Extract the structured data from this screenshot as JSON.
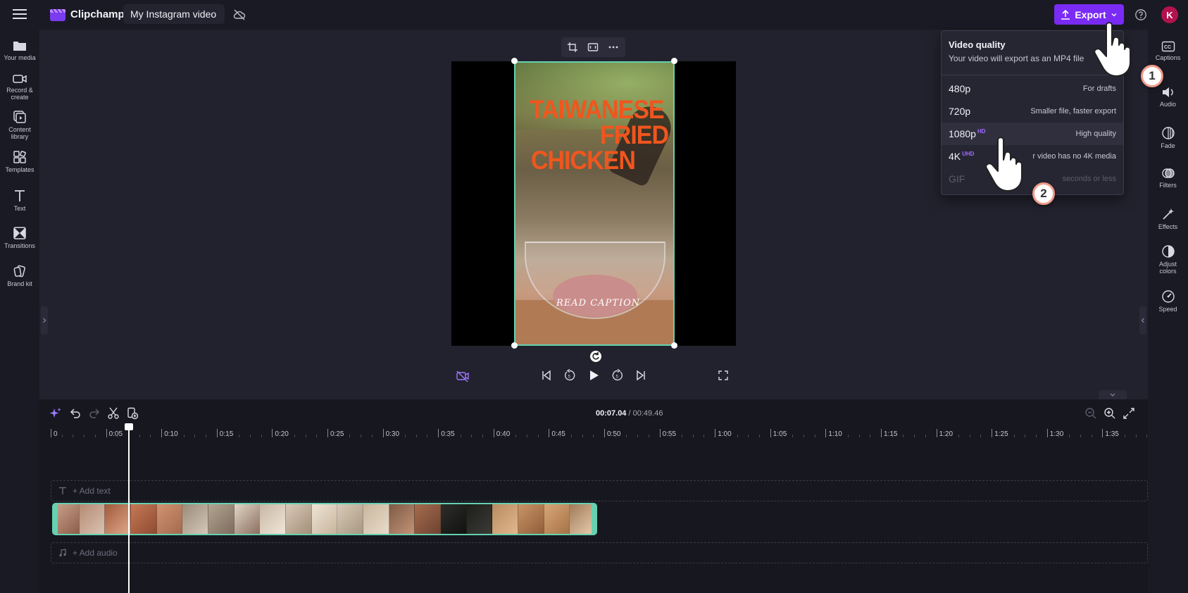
{
  "app": {
    "name": "Clipchamp",
    "project_title": "My Instagram video",
    "avatar_initial": "K",
    "export_label": "Export",
    "accent_color": "#7a2bf5"
  },
  "left_sidebar": {
    "items": [
      {
        "label": "Your media",
        "icon": "folder-icon"
      },
      {
        "label": "Record &",
        "label2": "create",
        "icon": "camera-icon"
      },
      {
        "label": "Content",
        "label2": "library",
        "icon": "library-icon"
      },
      {
        "label": "Templates",
        "icon": "templates-icon"
      },
      {
        "label": "Text",
        "icon": "text-icon"
      },
      {
        "label": "Transitions",
        "icon": "transitions-icon"
      },
      {
        "label": "Brand kit",
        "icon": "brand-kit-icon"
      }
    ]
  },
  "right_sidebar": {
    "items": [
      {
        "label": "Captions",
        "icon": "captions-icon"
      },
      {
        "label": "Audio",
        "icon": "audio-icon"
      },
      {
        "label": "Fade",
        "icon": "fade-icon"
      },
      {
        "label": "Filters",
        "icon": "filters-icon"
      },
      {
        "label": "Effects",
        "icon": "effects-icon"
      },
      {
        "label": "Adjust",
        "label2": "colors",
        "icon": "adjust-colors-icon"
      },
      {
        "label": "Speed",
        "icon": "speed-icon"
      }
    ]
  },
  "export_dropdown": {
    "title": "Video quality",
    "subtitle": "Your video will export as an MP4 file",
    "options": [
      {
        "res": "480p",
        "badge": "",
        "desc": "For drafts"
      },
      {
        "res": "720p",
        "badge": "",
        "desc": "Smaller file, faster export"
      },
      {
        "res": "1080p",
        "badge": "HD",
        "desc": "High quality"
      },
      {
        "res": "4K",
        "badge": "UHD",
        "desc": "r video has no 4K media"
      },
      {
        "res": "GIF",
        "badge": "",
        "desc": "seconds or less"
      }
    ]
  },
  "preview": {
    "headline_1": "TAIWANESE",
    "headline_2": "FRIED",
    "headline_3": "CHICKEN",
    "caption": "READ CAPTION"
  },
  "timeline": {
    "current_time": "00:07.04",
    "total_time": "/ 00:49.46",
    "ruler_labels": [
      "0",
      "0:05",
      "0:10",
      "0:15",
      "0:20",
      "0:25",
      "0:30",
      "0:35",
      "0:40",
      "0:45",
      "0:50",
      "0:55",
      "1:00",
      "1:05",
      "1:10",
      "1:15",
      "1:20",
      "1:25",
      "1:30",
      "1:35"
    ],
    "add_text_label": "+ Add text",
    "add_audio_label": "+ Add audio"
  },
  "annotations": {
    "step_1": "1",
    "step_2": "2"
  }
}
